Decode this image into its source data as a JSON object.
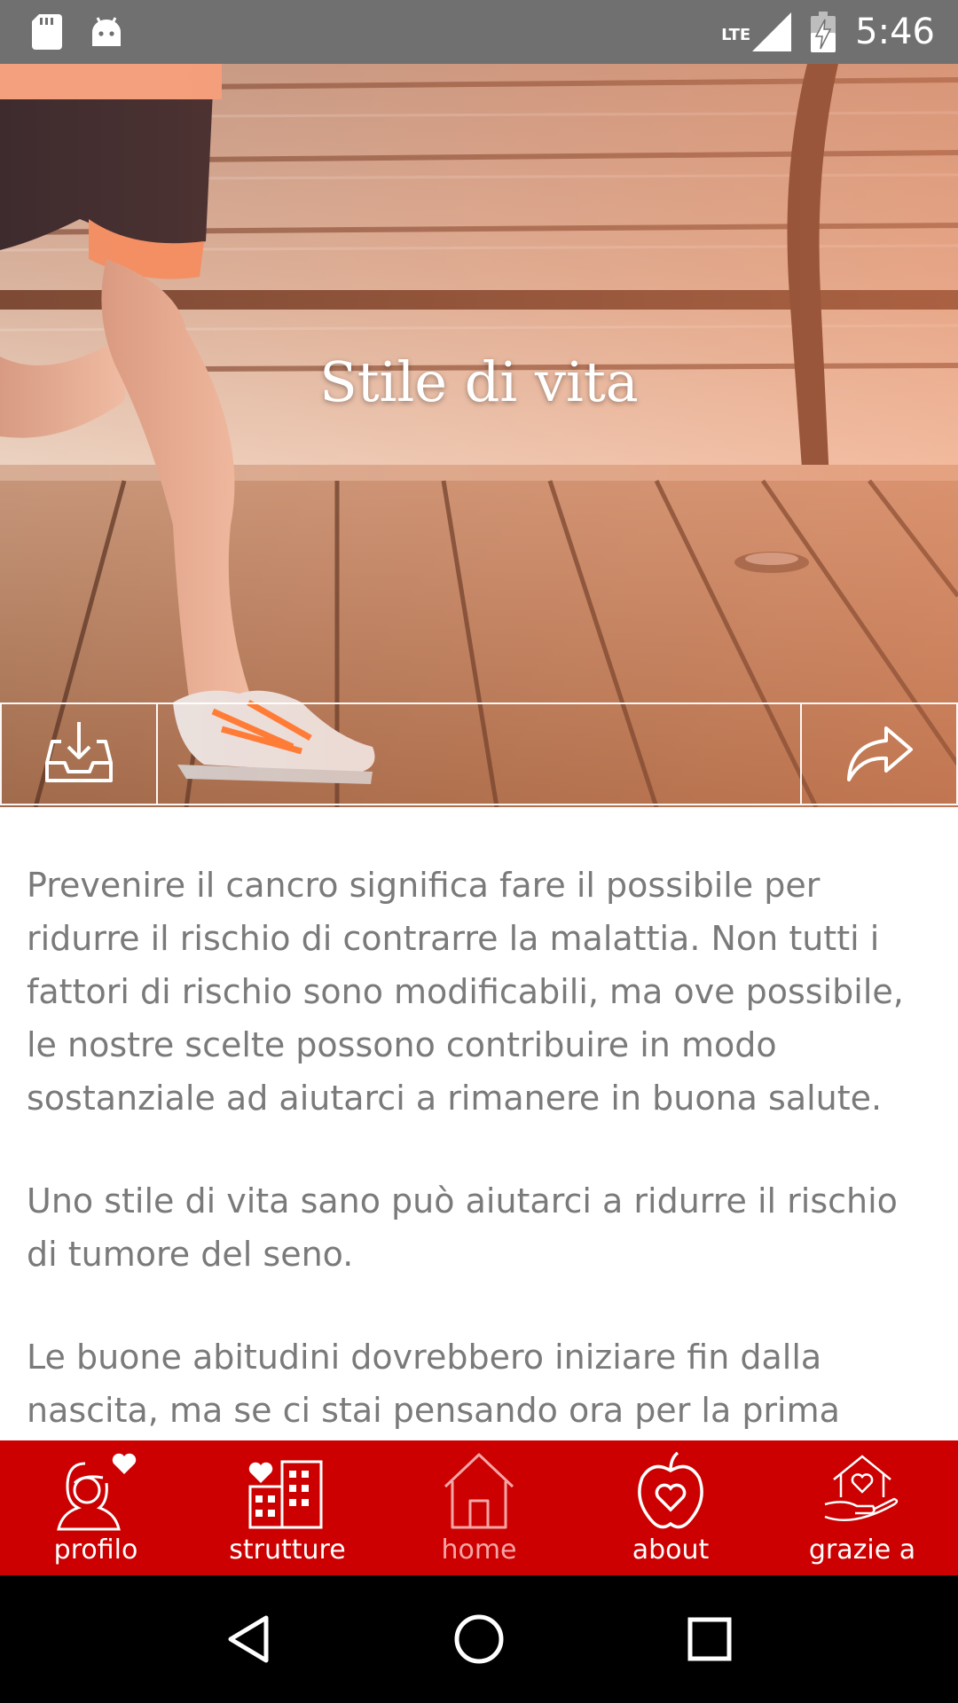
{
  "status_bar": {
    "time": "5:46",
    "network": "LTE",
    "icons": [
      "sd-card-icon",
      "android-icon",
      "signal-icon",
      "battery-charging-icon"
    ]
  },
  "hero": {
    "title": "Stile di vita",
    "actions": {
      "download_icon": "download-tray-icon",
      "share_icon": "share-arrow-icon"
    }
  },
  "article": {
    "paragraphs": [
      "Prevenire il cancro significa fare il possibile per ridurre il rischio di contrarre la malattia. Non tutti i fattori di rischio sono modificabili, ma ove possibile, le nostre scelte possono contribuire in modo sostanziale ad aiutarci a rimanere in buona salute.",
      "Uno stile di vita sano può aiutarci a ridurre il rischio di tumore del seno.",
      "Le buone abitudini dovrebbero iniziare fin dalla nascita, ma se ci stai pensando ora per la prima"
    ]
  },
  "bottom_nav": {
    "items": [
      {
        "label": "profilo",
        "icon": "profile-heart-icon",
        "active": false
      },
      {
        "label": "strutture",
        "icon": "buildings-heart-icon",
        "active": false
      },
      {
        "label": "home",
        "icon": "home-icon",
        "active": true
      },
      {
        "label": "about",
        "icon": "apple-heart-icon",
        "active": false
      },
      {
        "label": "grazie a",
        "icon": "hand-heart-house-icon",
        "active": false
      }
    ],
    "background": "#cc0000",
    "active_color": "#f5a6a6"
  },
  "system_nav": {
    "icons": [
      "back-icon",
      "home-circle-icon",
      "recents-icon"
    ]
  }
}
